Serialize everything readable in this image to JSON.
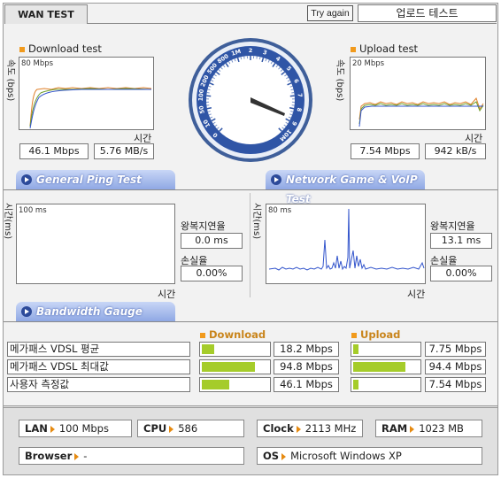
{
  "header": {
    "tab_label": "WAN TEST",
    "try_again_label": "Try again",
    "title": "업로드 테스트"
  },
  "download": {
    "label": "Download test",
    "scale": "80 Mbps",
    "ylabel": "속도 (bps)",
    "xlabel": "시간",
    "speed_mbps": "46.1 Mbps",
    "speed_mbs": "5.76 MB/s"
  },
  "upload": {
    "label": "Upload test",
    "scale": "20 Mbps",
    "ylabel": "속도 (bps)",
    "xlabel": "시간",
    "speed_mbps": "7.54 Mbps",
    "speed_kbs": "942 kB/s"
  },
  "gauge": {
    "labels": [
      "0",
      "10",
      "50",
      "100",
      "200",
      "500",
      "800",
      "1M",
      "2",
      "3",
      "4",
      "5",
      "6",
      "7",
      "8",
      "9",
      "10M"
    ],
    "needle_value": "8"
  },
  "ping": {
    "tab_label": "General Ping Test",
    "scale": "100 ms",
    "ylabel": "시간(ms)",
    "xlabel": "시간",
    "rtt_label": "왕복지연율",
    "rtt_value": "0.0 ms",
    "loss_label": "손실율",
    "loss_value": "0.00%"
  },
  "game": {
    "tab_label": "Network Game & VoIP Test",
    "scale": "80 ms",
    "ylabel": "시간(ms)",
    "xlabel": "시간",
    "rtt_label": "왕복지연율",
    "rtt_value": "13.1 ms",
    "loss_label": "손실율",
    "loss_value": "0.00%"
  },
  "bandwidth": {
    "tab_label": "Bandwidth Gauge",
    "download_label": "Download",
    "upload_label": "Upload",
    "rows": [
      {
        "label": "메가패스 VDSL 평균",
        "down_value": "18.2 Mbps",
        "down_fraction": 0.182,
        "up_value": "7.75 Mbps",
        "up_fraction": 0.078
      },
      {
        "label": "메가패스 VDSL 최대값",
        "down_value": "94.8 Mbps",
        "down_fraction": 0.775,
        "up_value": "94.4 Mbps",
        "up_fraction": 0.77
      },
      {
        "label": "사용자 측정값",
        "down_value": "46.1 Mbps",
        "down_fraction": 0.4,
        "up_value": "7.54 Mbps",
        "up_fraction": 0.075
      }
    ]
  },
  "system": {
    "lan_label": "LAN",
    "lan_value": "100 Mbps",
    "cpu_label": "CPU",
    "cpu_value": "586",
    "clock_label": "Clock",
    "clock_value": "2113 MHz",
    "ram_label": "RAM",
    "ram_value": "1023 MB",
    "browser_label": "Browser",
    "browser_value": "-",
    "os_label": "OS",
    "os_value": "Microsoft Windows XP"
  },
  "colors": {
    "bar_fill": "#a5cc2a",
    "accent_orange": "#f19a1c",
    "tab_blue": "#8fa8e4"
  }
}
